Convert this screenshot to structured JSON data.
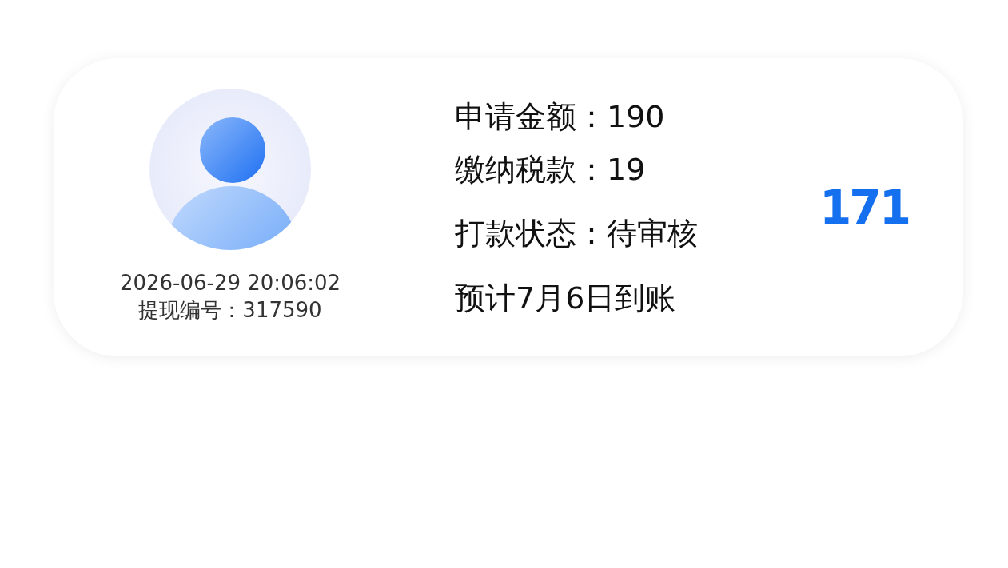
{
  "record": {
    "datetime": "2026-06-29 20:06:02",
    "withdrawal_number": "提现编号：317590",
    "details": [
      "申请金额：190",
      "缴纳税款：19",
      "打款状态：待审核"
    ],
    "arrival_note": "预计7月6日到账",
    "net_amount": "171"
  }
}
